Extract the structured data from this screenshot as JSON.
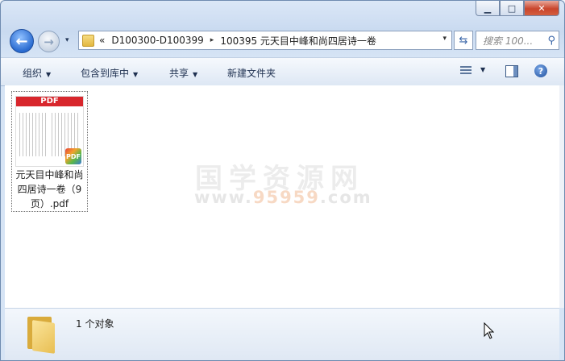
{
  "window": {
    "caption_buttons": {
      "minimize": "▁",
      "maximize": "□",
      "close": "✕"
    }
  },
  "navigation": {
    "back_label": "←",
    "forward_label": "→",
    "history_glyph": "▾",
    "breadcrumb": {
      "overflow": "«",
      "parent": "D100300-D100399",
      "separator": "▸",
      "current": "100395 元天目中峰和尚四居诗一卷",
      "dropdown_glyph": "▾"
    },
    "refresh_glyph": "⇆",
    "search_placeholder": "搜索 100...",
    "search_glyph": "⚲"
  },
  "toolbar": {
    "organize": "组织",
    "include_in_library": "包含到库中",
    "share": "共享",
    "new_folder": "新建文件夹",
    "arrow": "▼",
    "help": "?"
  },
  "content": {
    "watermark_cn": "国学资源网",
    "watermark_url_prefix": "www.",
    "watermark_url_num": "95959",
    "watermark_url_suffix": ".com",
    "files": [
      {
        "name": "元天目中峰和尚四居诗一卷（9页）.pdf",
        "thumb_header": "PDF",
        "badge": "PDF"
      }
    ]
  },
  "status": {
    "count_text": "1 个对象"
  }
}
